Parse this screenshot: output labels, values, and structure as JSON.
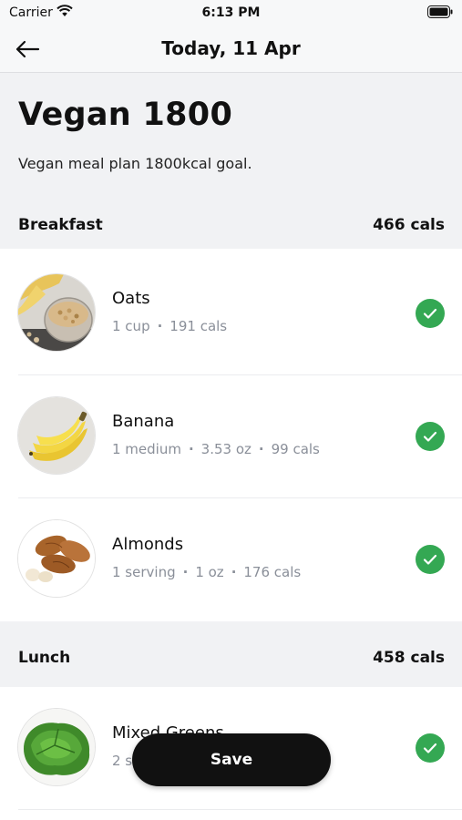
{
  "status_bar": {
    "carrier": "Carrier",
    "time": "6:13 PM"
  },
  "nav": {
    "title": "Today, 11 Apr"
  },
  "plan": {
    "title": "Vegan 1800",
    "description": "Vegan meal plan 1800kcal goal."
  },
  "sections": [
    {
      "name": "Breakfast",
      "cals": "466 cals",
      "items": [
        {
          "name": "Oats",
          "meta": [
            "1 cup",
            "191 cals"
          ],
          "image": "oats-image",
          "checked": true
        },
        {
          "name": "Banana",
          "meta": [
            "1 medium",
            "3.53 oz",
            "99 cals"
          ],
          "image": "banana-image",
          "checked": true
        },
        {
          "name": "Almonds",
          "meta": [
            "1 serving",
            "1 oz",
            "176 cals"
          ],
          "image": "almonds-image",
          "checked": true
        }
      ]
    },
    {
      "name": "Lunch",
      "cals": "458 cals",
      "items": [
        {
          "name": "Mixed Greens",
          "meta": [
            "2 s",
            "s"
          ],
          "image": "mixed-greens-image",
          "checked": true
        }
      ]
    }
  ],
  "save_button": {
    "label": "Save"
  },
  "colors": {
    "check": "#34a853",
    "header_bg": "#f1f2f4",
    "meta_text": "#8a8f99",
    "button_bg": "#111111"
  }
}
